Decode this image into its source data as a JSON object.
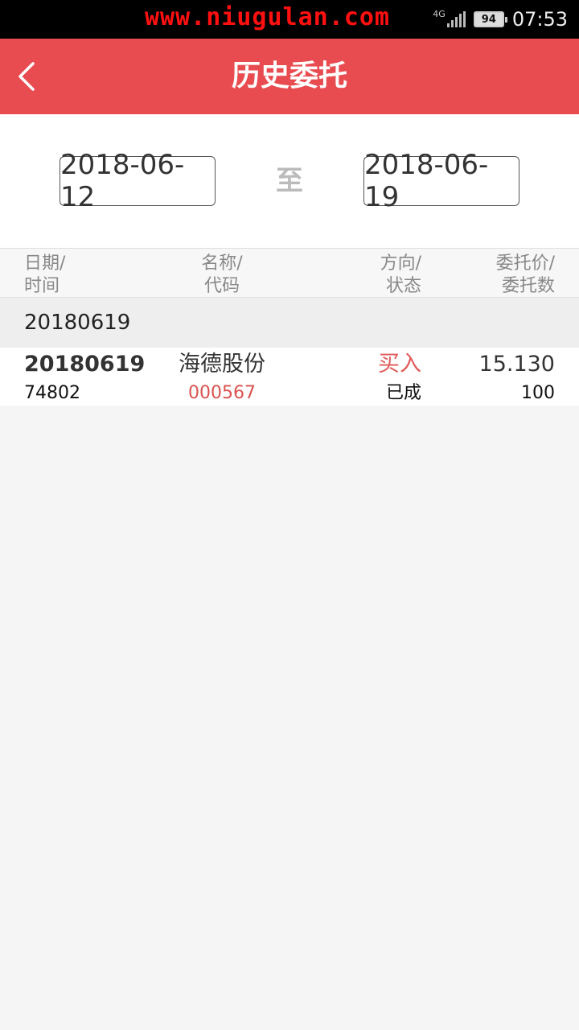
{
  "status_bar": {
    "watermark": "www.niugulan.com",
    "network": "4G",
    "battery": "94",
    "time": "07:53"
  },
  "header": {
    "title": "历史委托",
    "back_icon": "chevron-left-icon"
  },
  "date_range": {
    "start": "2018-06-12",
    "separator": "至",
    "end": "2018-06-19"
  },
  "table": {
    "columns": [
      {
        "line1": "日期/",
        "line2": "时间"
      },
      {
        "line1": "名称/",
        "line2": "代码"
      },
      {
        "line1": "方向/",
        "line2": "状态"
      },
      {
        "line1": "委托价/",
        "line2": "委托数"
      }
    ],
    "groups": [
      {
        "date": "20180619",
        "rows": [
          {
            "date": "20180619",
            "time": "74802",
            "name": "海德股份",
            "code": "000567",
            "direction": "买入",
            "status": "已成",
            "price": "15.130",
            "quantity": "100"
          }
        ]
      }
    ]
  },
  "colors": {
    "accent": "#e84c50",
    "buy": "#e05a5a"
  }
}
